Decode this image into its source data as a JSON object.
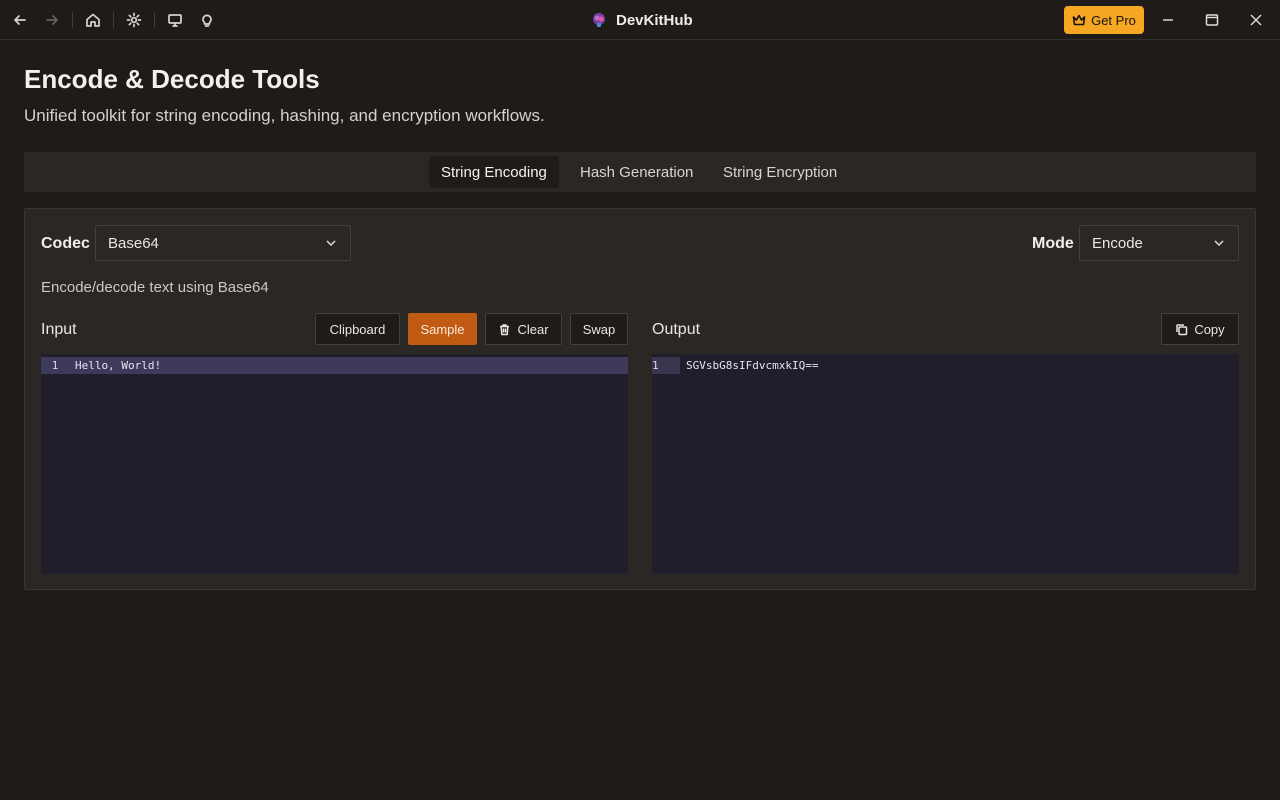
{
  "app": {
    "title": "DevKitHub",
    "get_pro_label": "Get Pro"
  },
  "icons": {
    "back": "arrow-left-icon",
    "forward": "arrow-right-icon",
    "home": "home-icon",
    "settings": "gear-icon",
    "display": "monitor-icon",
    "idea": "lightbulb-icon",
    "logo": "brain-icon",
    "crown": "crown-icon",
    "minimize": "minimize-icon",
    "maximize": "maximize-icon",
    "close": "close-icon"
  },
  "page": {
    "title": "Encode & Decode Tools",
    "subtitle": "Unified toolkit for string encoding, hashing, and encryption workflows."
  },
  "tabs": [
    {
      "label": "String Encoding",
      "active": true
    },
    {
      "label": "Hash Generation",
      "active": false
    },
    {
      "label": "String Encryption",
      "active": false
    }
  ],
  "panel": {
    "codec_label": "Codec",
    "codec_value": "Base64",
    "mode_label": "Mode",
    "mode_value": "Encode",
    "description": "Encode/decode text using Base64",
    "input": {
      "label": "Input",
      "buttons": {
        "clipboard": "Clipboard",
        "sample": "Sample",
        "clear": "Clear",
        "swap": "Swap"
      },
      "lines": [
        {
          "number": "1",
          "text": "Hello, World!"
        }
      ]
    },
    "output": {
      "label": "Output",
      "copy_label": "Copy",
      "lines": [
        {
          "number": "1",
          "text": "SGVsbG8sIFdvcmxkIQ=="
        }
      ]
    }
  },
  "colors": {
    "accent": "#c15a12",
    "pro": "#f5a623",
    "background": "#1e1b19",
    "editor": "#211e2c"
  }
}
